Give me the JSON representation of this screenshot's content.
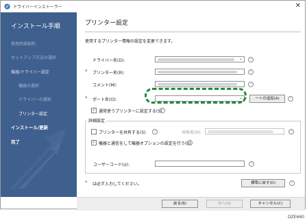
{
  "window": {
    "title": "ドライバーインストーラー",
    "close_glyph": "✕"
  },
  "sidebar": {
    "heading": "インストール手順",
    "items": [
      {
        "label": "使用許諾契約"
      },
      {
        "label": "セットアップ方法の選択"
      },
      {
        "label": "機器/ドライバー設定"
      },
      {
        "label": "機器の選択"
      },
      {
        "label": "ドライバーの選択"
      },
      {
        "label": "プリンター設定"
      },
      {
        "label": "インストール/更新"
      },
      {
        "label": "完了"
      }
    ]
  },
  "main": {
    "title": "プリンター設定",
    "description": "使用するプリンター情報の設定を変更できます。",
    "fields": {
      "driver_name": {
        "label": "ドライバー名(D):"
      },
      "printer_name": {
        "label": "プリンター名(R):"
      },
      "comment": {
        "label": "コメント(M):"
      },
      "port_name": {
        "label": "ポート名(O):"
      }
    },
    "add_port_button": "ートの追加(A)",
    "default_printer_checkbox": {
      "label": "通常使うプリンターに設定する(S)",
      "checked": true
    },
    "details": {
      "legend": "詳細設定",
      "share_checkbox": {
        "label": "プリンターを共有する(S)",
        "checked": false
      },
      "share_name_label": "共有名(H):",
      "options_checkbox": {
        "label": "機器と通信をして機器オプションの設定を行う(U)",
        "checked": true
      },
      "user_code_label": "ユーザーコード(U):"
    },
    "required_note": "は必ず入力してください。",
    "restore_default_button": "標準に戻す(D)",
    "info_glyph": "i",
    "checkmark_glyph": "✓",
    "dropdown_glyph": "⌄",
    "required_glyph": "*"
  },
  "footer": {
    "back_button": "戻る(B)",
    "next_button": "次へ(N)",
    "cancel_button": "キャンセル(C)"
  },
  "figure_id": "DZE660",
  "colors": {
    "sidebar_bg": "#3f5f8e",
    "required": "#c8161d",
    "highlight": "#1f8a3b"
  }
}
